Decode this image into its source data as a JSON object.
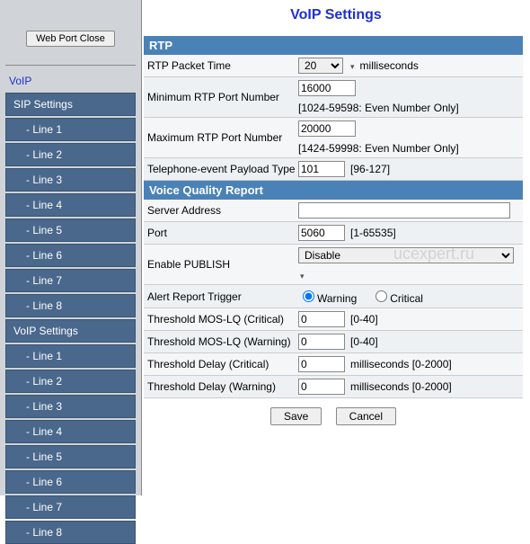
{
  "sidebar": {
    "webport_label": "Web Port Close",
    "voip_label": "VoIP",
    "sip_settings_label": "SIP Settings",
    "voip_settings_label": "VoIP Settings",
    "lines": [
      "- Line 1",
      "- Line 2",
      "- Line 3",
      "- Line 4",
      "- Line 5",
      "- Line 6",
      "- Line 7",
      "- Line 8"
    ]
  },
  "page": {
    "title": "VoIP Settings",
    "watermark": "ucexpert.ru"
  },
  "rtp": {
    "section_title": "RTP",
    "packet_time_label": "RTP Packet Time",
    "packet_time_value": "20",
    "packet_time_unit": "milliseconds",
    "min_port_label": "Minimum RTP Port Number",
    "min_port_value": "16000",
    "min_port_hint": "[1024-59598: Even Number Only]",
    "max_port_label": "Maximum RTP Port Number",
    "max_port_value": "20000",
    "max_port_hint": "[1424-59998: Even Number Only]",
    "tel_evt_label": "Telephone-event Payload Type",
    "tel_evt_value": "101",
    "tel_evt_hint": "[96-127]"
  },
  "vqr": {
    "section_title": "Voice Quality Report",
    "server_label": "Server Address",
    "server_value": "",
    "port_label": "Port",
    "port_value": "5060",
    "port_hint": "[1-65535]",
    "publish_label": "Enable PUBLISH",
    "publish_value": "Disable",
    "alert_label": "Alert Report Trigger",
    "alert_warning": "Warning",
    "alert_critical": "Critical",
    "mos_crit_label": "Threshold MOS-LQ (Critical)",
    "mos_crit_value": "0",
    "mos_crit_hint": "[0-40]",
    "mos_warn_label": "Threshold MOS-LQ (Warning)",
    "mos_warn_value": "0",
    "mos_warn_hint": "[0-40]",
    "delay_crit_label": "Threshold Delay (Critical)",
    "delay_crit_value": "0",
    "delay_crit_hint": "milliseconds [0-2000]",
    "delay_warn_label": "Threshold Delay (Warning)",
    "delay_warn_value": "0",
    "delay_warn_hint": "milliseconds [0-2000]"
  },
  "footer": {
    "save": "Save",
    "cancel": "Cancel"
  }
}
